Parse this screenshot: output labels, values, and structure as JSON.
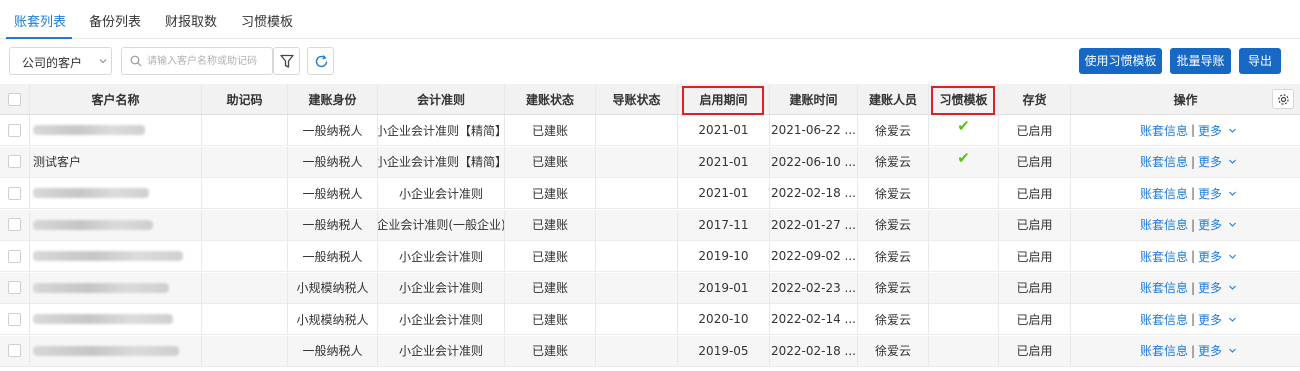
{
  "tabs": [
    {
      "label": "账套列表",
      "active": true
    },
    {
      "label": "备份列表",
      "active": false
    },
    {
      "label": "财报取数",
      "active": false
    },
    {
      "label": "习惯模板",
      "active": false
    }
  ],
  "toolbar": {
    "customer_filter": "公司的客户",
    "search_placeholder": "请输入客户名称或助记码",
    "use_template_label": "使用习惯模板",
    "batch_import_label": "批量导账",
    "export_label": "导出"
  },
  "table": {
    "columns": [
      "客户名称",
      "助记码",
      "建账身份",
      "会计准则",
      "建账状态",
      "导账状态",
      "启用期间",
      "建账时间",
      "建账人员",
      "习惯模板",
      "存货",
      "操作"
    ],
    "highlighted_columns": [
      "启用期间",
      "习惯模板"
    ],
    "rows": [
      {
        "name": "",
        "name_blurred": true,
        "mnemonic": "",
        "identity": "一般纳税人",
        "standard": "小企业会计准则【精简】",
        "status": "已建账",
        "import_status": "",
        "period": "2021-01",
        "created": "2021-06-22 ...",
        "creator": "徐爱云",
        "template": true,
        "inventory": "已启用"
      },
      {
        "name": "测试客户",
        "name_blurred": false,
        "mnemonic": "",
        "identity": "一般纳税人",
        "standard": "小企业会计准则【精简】",
        "status": "已建账",
        "import_status": "",
        "period": "2021-01",
        "created": "2022-06-10 ...",
        "creator": "徐爱云",
        "template": true,
        "inventory": "已启用"
      },
      {
        "name": "",
        "name_blurred": true,
        "mnemonic": "",
        "identity": "一般纳税人",
        "standard": "小企业会计准则",
        "status": "已建账",
        "import_status": "",
        "period": "2021-01",
        "created": "2022-02-18 ...",
        "creator": "徐爱云",
        "template": false,
        "inventory": "已启用"
      },
      {
        "name": "",
        "name_blurred": true,
        "mnemonic": "",
        "identity": "一般纳税人",
        "standard": "企业会计准则(一般企业)",
        "status": "已建账",
        "import_status": "",
        "period": "2017-11",
        "created": "2022-01-27 ...",
        "creator": "徐爱云",
        "template": false,
        "inventory": "已启用"
      },
      {
        "name": "",
        "name_blurred": true,
        "mnemonic": "",
        "identity": "一般纳税人",
        "standard": "小企业会计准则",
        "status": "已建账",
        "import_status": "",
        "period": "2019-10",
        "created": "2022-09-02 ...",
        "creator": "徐爱云",
        "template": false,
        "inventory": "已启用"
      },
      {
        "name": "",
        "name_blurred": true,
        "mnemonic": "",
        "identity": "小规模纳税人",
        "standard": "小企业会计准则",
        "status": "已建账",
        "import_status": "",
        "period": "2019-01",
        "created": "2022-02-23 ...",
        "creator": "徐爱云",
        "template": false,
        "inventory": "已启用"
      },
      {
        "name": "",
        "name_blurred": true,
        "mnemonic": "",
        "identity": "小规模纳税人",
        "standard": "小企业会计准则",
        "status": "已建账",
        "import_status": "",
        "period": "2020-10",
        "created": "2022-02-14 ...",
        "creator": "徐爱云",
        "template": false,
        "inventory": "已启用"
      },
      {
        "name": "",
        "name_blurred": true,
        "mnemonic": "",
        "identity": "一般纳税人",
        "standard": "小企业会计准则",
        "status": "已建账",
        "import_status": "",
        "period": "2019-05",
        "created": "2022-02-18 ...",
        "creator": "徐爱云",
        "template": false,
        "inventory": "已启用"
      }
    ],
    "row_actions": {
      "info": "账套信息",
      "more": "更多",
      "separator": "|"
    }
  },
  "icons": {
    "filter": "filter-icon",
    "refresh": "refresh-icon",
    "search": "search-icon",
    "settings": "gear-icon",
    "check": "check-icon",
    "dropdown": "chevron-down-icon"
  },
  "colors": {
    "primary": "#1768c4",
    "link": "#1e7bd8",
    "check": "#52c41a",
    "highlight": "#e02020"
  }
}
